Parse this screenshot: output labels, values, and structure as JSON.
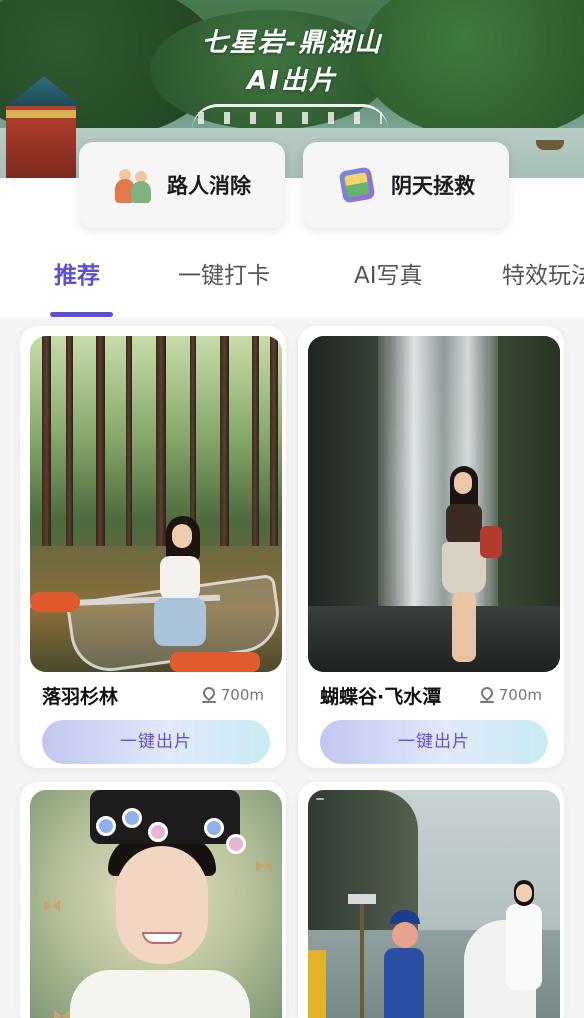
{
  "hero": {
    "title": "七星岩-鼎湖山",
    "subtitle": "AI出片"
  },
  "features": [
    {
      "label": "路人消除",
      "icon": "people-remove-icon"
    },
    {
      "label": "阴天拯救",
      "icon": "photo-fix-icon"
    }
  ],
  "tabs": [
    {
      "label": "推荐",
      "active": true
    },
    {
      "label": "一键打卡",
      "active": false
    },
    {
      "label": "AI写真",
      "active": false
    },
    {
      "label": "特效玩法",
      "active": false
    }
  ],
  "cards": [
    {
      "title": "落羽杉林",
      "distance": "700m",
      "button": "一键出片"
    },
    {
      "title": "蝴蝶谷·飞水潭",
      "distance": "700m",
      "button": "一键出片"
    },
    {
      "title": "",
      "distance": "",
      "button": ""
    },
    {
      "title": "",
      "distance": "",
      "button": ""
    }
  ],
  "colors": {
    "accent": "#5b4fd6",
    "button_text": "#6352cc",
    "background": "#f4f4f6"
  }
}
